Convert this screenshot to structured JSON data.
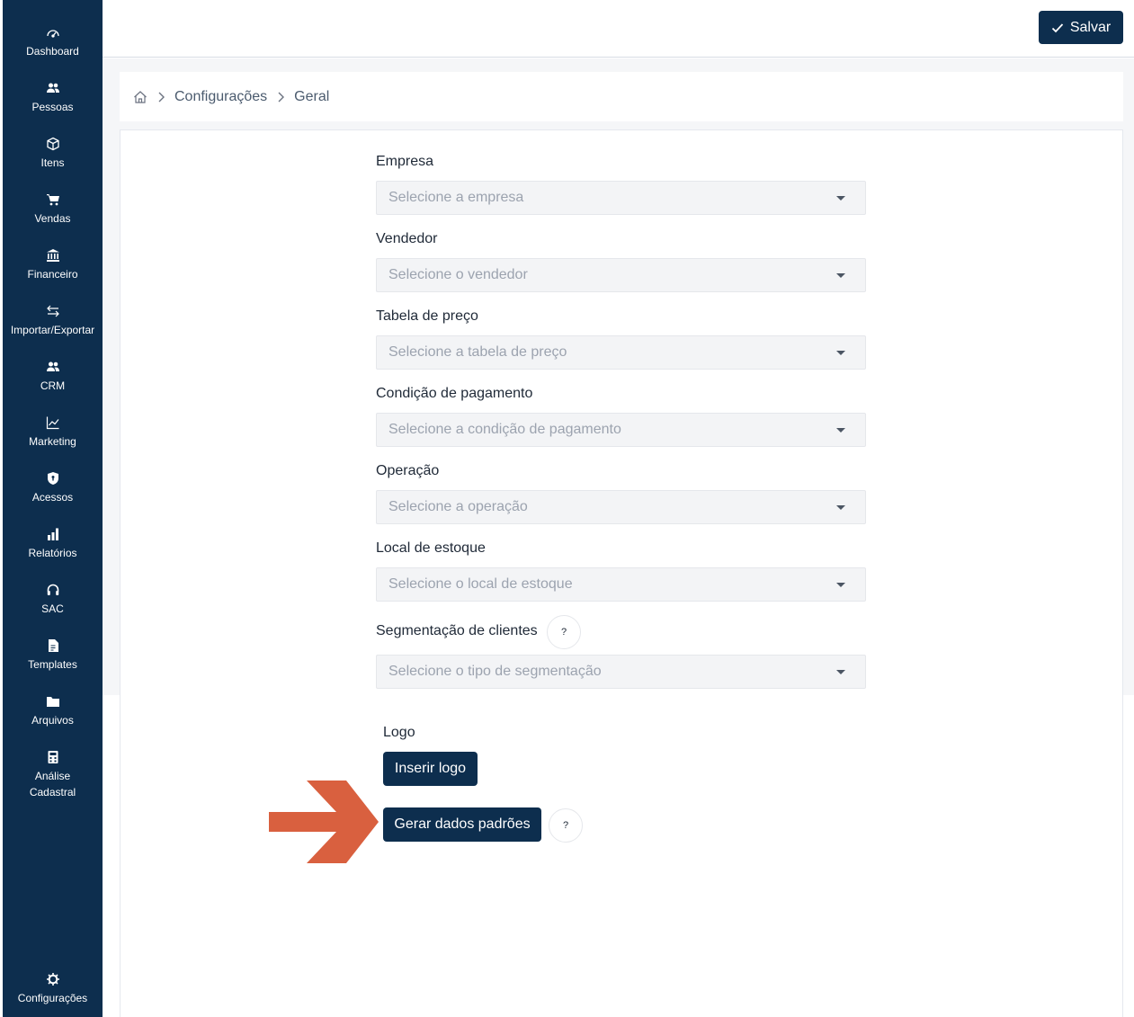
{
  "sidebar": {
    "items": [
      {
        "label": "Dashboard",
        "icon": "dashboard-gauge-icon"
      },
      {
        "label": "Pessoas",
        "icon": "people-icon"
      },
      {
        "label": "Itens",
        "icon": "box-icon"
      },
      {
        "label": "Vendas",
        "icon": "cart-icon"
      },
      {
        "label": "Financeiro",
        "icon": "bank-icon"
      },
      {
        "label": "Importar/Exportar",
        "icon": "swap-arrows-icon"
      },
      {
        "label": "CRM",
        "icon": "people-icon"
      },
      {
        "label": "Marketing",
        "icon": "line-chart-icon"
      },
      {
        "label": "Acessos",
        "icon": "shield-icon"
      },
      {
        "label": "Relatórios",
        "icon": "bar-chart-icon"
      },
      {
        "label": "SAC",
        "icon": "headset-icon"
      },
      {
        "label": "Templates",
        "icon": "document-icon"
      },
      {
        "label": "Arquivos",
        "icon": "folder-icon"
      },
      {
        "label": "Análise\nCadastral",
        "icon": "calculator-icon"
      }
    ],
    "footer": {
      "label": "Configurações",
      "icon": "gear-icon"
    }
  },
  "header": {
    "save_label": "Salvar"
  },
  "breadcrumb": {
    "items": [
      "Configurações",
      "Geral"
    ]
  },
  "form": {
    "fields": [
      {
        "label": "Empresa",
        "placeholder": "Selecione a empresa"
      },
      {
        "label": "Vendedor",
        "placeholder": "Selecione o vendedor"
      },
      {
        "label": "Tabela de preço",
        "placeholder": "Selecione a tabela de preço"
      },
      {
        "label": "Condição de pagamento",
        "placeholder": "Selecione a condição de pagamento"
      },
      {
        "label": "Operação",
        "placeholder": "Selecione a operação"
      },
      {
        "label": "Local de estoque",
        "placeholder": "Selecione o local de estoque"
      },
      {
        "label": "Segmentação de clientes",
        "placeholder": "Selecione o tipo de segmentação"
      }
    ],
    "help_symbol": "?",
    "logo_label": "Logo",
    "insert_logo_label": "Inserir logo",
    "generate_label": "Gerar dados padrões"
  },
  "colors": {
    "sidebar": "#0d2e4e",
    "primary": "#0d2e4e",
    "arrow": "#d9603f"
  }
}
